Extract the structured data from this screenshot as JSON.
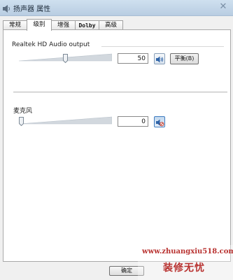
{
  "window": {
    "title": "扬声器 属性"
  },
  "tabs": [
    {
      "label": "常规"
    },
    {
      "label": "级别"
    },
    {
      "label": "增强"
    },
    {
      "label": "Dolby"
    },
    {
      "label": "高级"
    }
  ],
  "active_tab": "级别",
  "levels": [
    {
      "device": "Realtek HD Audio output",
      "value": "50",
      "level": 50,
      "muted": false,
      "balance_label": "平衡(B)"
    },
    {
      "device": "麦克风",
      "value": "0",
      "level": 0,
      "muted": true
    }
  ],
  "footer": {
    "ok_label": "确定"
  },
  "watermark": {
    "url": "www.zhuangxiu518.com",
    "name": "装修无忧"
  },
  "colors": {
    "accent": "#3f7cc0",
    "watermark": "#b8312f"
  }
}
